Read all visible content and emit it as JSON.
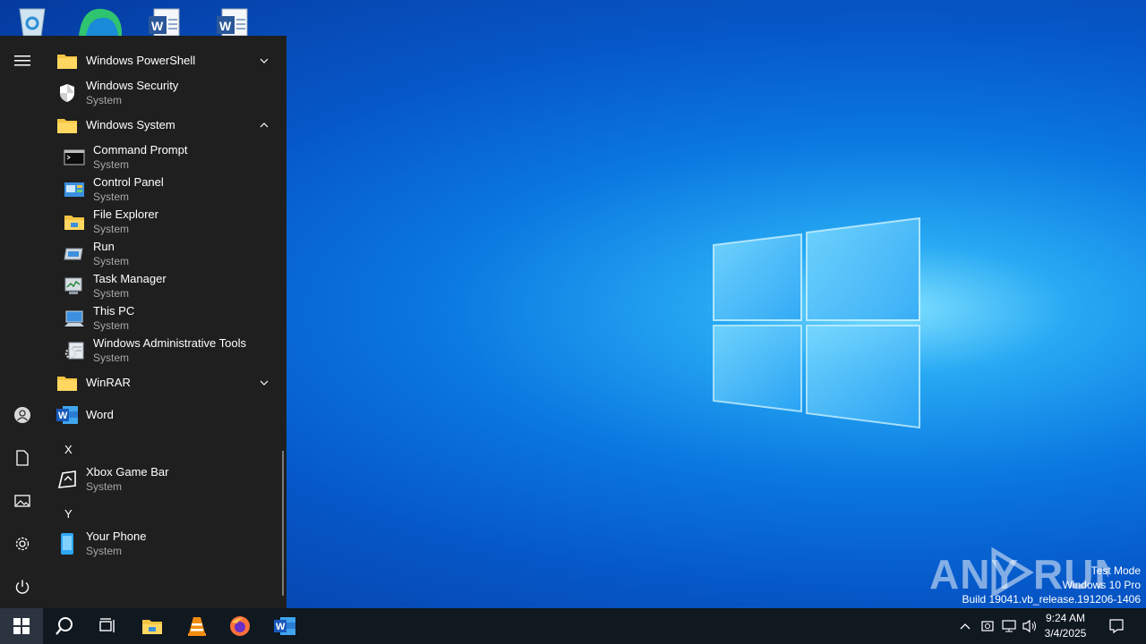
{
  "start_menu": {
    "items": [
      {
        "name": "Windows PowerShell",
        "type": "folder",
        "expanded": false
      },
      {
        "name": "Windows Security",
        "sub": "System"
      },
      {
        "name": "Windows System",
        "type": "folder",
        "expanded": true
      },
      {
        "name": "Command Prompt",
        "sub": "System"
      },
      {
        "name": "Control Panel",
        "sub": "System"
      },
      {
        "name": "File Explorer",
        "sub": "System"
      },
      {
        "name": "Run",
        "sub": "System"
      },
      {
        "name": "Task Manager",
        "sub": "System"
      },
      {
        "name": "This PC",
        "sub": "System"
      },
      {
        "name": "Windows Administrative Tools",
        "sub": "System"
      },
      {
        "name": "WinRAR",
        "type": "folder",
        "expanded": false
      },
      {
        "name": "Word"
      },
      {
        "name": "Xbox Game Bar",
        "sub": "System"
      },
      {
        "name": "Your Phone",
        "sub": "System"
      }
    ],
    "letters": {
      "x": "X",
      "y": "Y"
    }
  },
  "watermark": {
    "line1": "Test Mode",
    "line2": "Windows 10 Pro",
    "line3": "Build 19041.vb_release.191206-1406",
    "brand": "ANY RUN"
  },
  "taskbar": {
    "time": "9:24 AM",
    "date": "3/4/2025"
  },
  "colors": {
    "start_bg": "#1f1f1f",
    "taskbar_bg": "#101820",
    "folder": "#f4c542",
    "word": "#2b579a"
  }
}
